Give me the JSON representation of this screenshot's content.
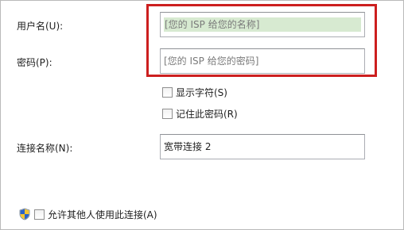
{
  "form": {
    "username_label": "用户名(U):",
    "username_value": "[您的 ISP 给您的名称]",
    "password_label": "密码(P):",
    "password_value": "[您的 ISP 给您的密码]",
    "show_chars_label": "显示字符(S)",
    "remember_password_label": "记住此密码(R)",
    "connection_name_label": "连接名称(N):",
    "connection_name_value": "宽带连接 2",
    "allow_others_label": "允许其他人使用此连接(A)"
  },
  "colors": {
    "highlight_border": "#cc1f1f",
    "selection_fill": "#d7ead1"
  },
  "icons": {
    "shield": "uac-shield-icon"
  }
}
